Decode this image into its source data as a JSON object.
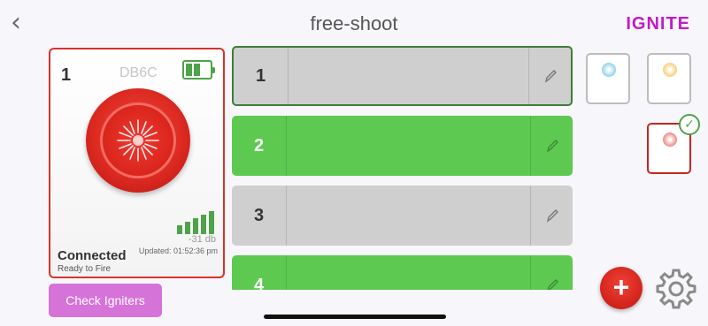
{
  "header": {
    "back_icon": "chevron-left-icon",
    "title": "free-shoot",
    "logo": "IGNITE"
  },
  "device": {
    "number": "1",
    "id": "DB6C",
    "battery_icon": "battery-icon",
    "battery_level": 0.5,
    "signal_bars": 5,
    "signal_db": "-31 db",
    "updated": "Updated: 01:52:36 pm",
    "status": "Connected",
    "substatus": "Ready to Fire"
  },
  "check_button": {
    "label": "Check Igniters"
  },
  "cues": [
    {
      "number": "1",
      "state": "selected",
      "color": "#cfcfcf"
    },
    {
      "number": "2",
      "state": "armed",
      "color": "#5dc951"
    },
    {
      "number": "3",
      "state": "idle",
      "color": "#cfcfcf"
    },
    {
      "number": "4",
      "state": "armed",
      "color": "#5dc951"
    }
  ],
  "swatches": [
    {
      "name": "blue",
      "color": "#8fd3ea",
      "selected": false
    },
    {
      "name": "yellow",
      "color": "#f4d27a",
      "selected": false
    },
    {
      "name": "red",
      "color": "#ee8a84",
      "selected": true
    }
  ],
  "actions": {
    "add_icon": "plus-icon",
    "add_glyph": "+",
    "settings_icon": "gear-icon",
    "edit_icon": "pencil-icon"
  },
  "colors": {
    "accent": "#c01cc4",
    "danger": "#d9322c",
    "success": "#5dc951"
  }
}
